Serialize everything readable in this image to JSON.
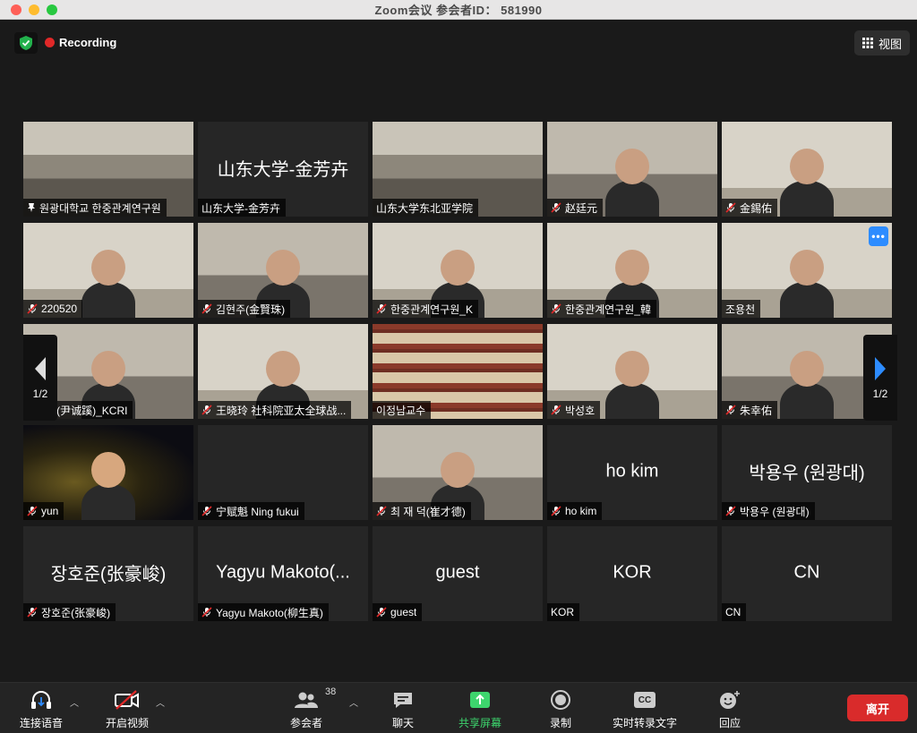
{
  "window": {
    "title": "Zoom会议 参会者ID：  581990"
  },
  "header": {
    "recording_label": "Recording",
    "view_label": "视图"
  },
  "grid": {
    "tiles": [
      {
        "label": "원광대학교 한중관계연구원",
        "icon": "pin-icon",
        "muted": false,
        "active": true,
        "scene": "room"
      },
      {
        "label": "山东大学-金芳卉",
        "big": "山东大学-金芳卉",
        "muted": false,
        "scene": "none"
      },
      {
        "label": "山东大学东北亚学院",
        "muted": false,
        "scene": "room"
      },
      {
        "label": "赵廷元",
        "muted": true,
        "scene": "office"
      },
      {
        "label": "金錫佑",
        "muted": true,
        "scene": "wall"
      },
      {
        "label": "220520",
        "muted": true,
        "scene": "wall"
      },
      {
        "label": "김현주(金賢珠)",
        "muted": true,
        "scene": "office"
      },
      {
        "label": "한중관계연구원_K",
        "muted": true,
        "scene": "wall"
      },
      {
        "label": "한중관계연구원_韓",
        "muted": true,
        "scene": "wall"
      },
      {
        "label": "조용천",
        "muted": false,
        "scene": "wall",
        "more": "•••"
      },
      {
        "label": "윤성혜(尹诚蹊)_KCRI",
        "muted": false,
        "scene": "office"
      },
      {
        "label": "王晓玲 社科院亚太全球战...",
        "muted": true,
        "scene": "wall"
      },
      {
        "label": "이정남교수",
        "muted": false,
        "scene": "shelf"
      },
      {
        "label": "박성호",
        "muted": true,
        "scene": "wall"
      },
      {
        "label": "朱幸佑",
        "muted": true,
        "scene": "office"
      },
      {
        "label": "yun",
        "muted": true,
        "scene": "night"
      },
      {
        "label": "宁赋魁 Ning fukui",
        "muted": true,
        "scene": "none"
      },
      {
        "label": "최 재 덕(崔才德)",
        "muted": true,
        "scene": "office"
      },
      {
        "label": "ho kim",
        "big": "ho kim",
        "muted": true,
        "scene": "none"
      },
      {
        "label": "박용우 (원광대)",
        "big": "박용우 (원광대)",
        "muted": true,
        "scene": "none"
      },
      {
        "label": "장호준(张豪峻)",
        "big": "장호준(张豪峻)",
        "muted": true,
        "scene": "none"
      },
      {
        "label": "Yagyu Makoto(柳生真)",
        "big": "Yagyu Makoto(...",
        "muted": true,
        "scene": "none"
      },
      {
        "label": "guest",
        "big": "guest",
        "muted": true,
        "scene": "none"
      },
      {
        "label": "KOR",
        "big": "KOR",
        "muted": false,
        "scene": "none"
      },
      {
        "label": "CN",
        "big": "CN",
        "muted": false,
        "scene": "none"
      }
    ]
  },
  "pagination": {
    "left": "1/2",
    "right": "1/2"
  },
  "toolbar": {
    "audio": "连接语音",
    "video": "开启视频",
    "participants": "参会者",
    "participants_count": "38",
    "chat": "聊天",
    "share": "共享屏幕",
    "record": "录制",
    "captions": "实时转录文字",
    "captions_icon_text": "CC",
    "reactions": "回应",
    "leave": "离开"
  },
  "colors": {
    "active_border": "#cfe253",
    "share_green": "#3dd56d",
    "leave_red": "#d92b2b",
    "mute_red": "#e02828"
  }
}
